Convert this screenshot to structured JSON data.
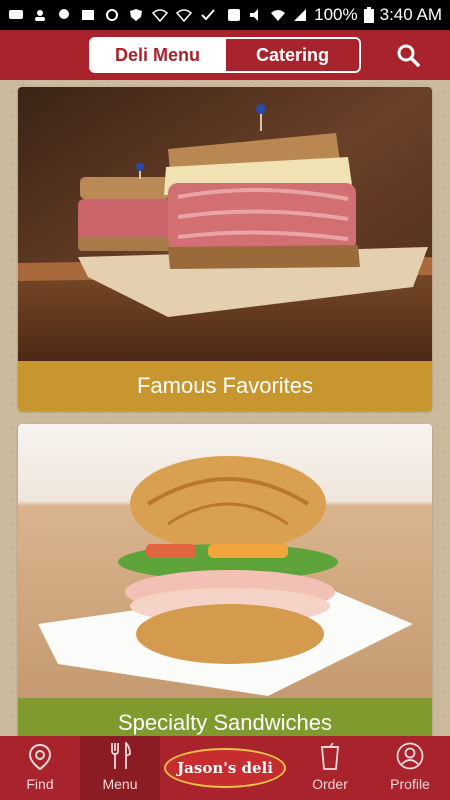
{
  "status_bar": {
    "battery": "100%",
    "time": "3:40 AM"
  },
  "header": {
    "tabs": [
      {
        "label": "Deli Menu",
        "active": true
      },
      {
        "label": "Catering",
        "active": false
      }
    ],
    "search_icon": "search-icon"
  },
  "cards": [
    {
      "label": "Famous Favorites",
      "color": "#c7962f"
    },
    {
      "label": "Specialty Sandwiches",
      "color": "#7f9a2d"
    }
  ],
  "bottom_nav": {
    "items": [
      {
        "label": "Find",
        "icon": "location-pin-icon"
      },
      {
        "label": "Menu",
        "icon": "fork-knife-icon",
        "active": true
      },
      {
        "label": "Order",
        "icon": "cup-icon"
      },
      {
        "label": "Profile",
        "icon": "user-icon"
      }
    ],
    "logo_text": "Jason's deli"
  },
  "colors": {
    "brand_red": "#a8232b",
    "gold": "#c7962f",
    "green": "#7f9a2d"
  }
}
